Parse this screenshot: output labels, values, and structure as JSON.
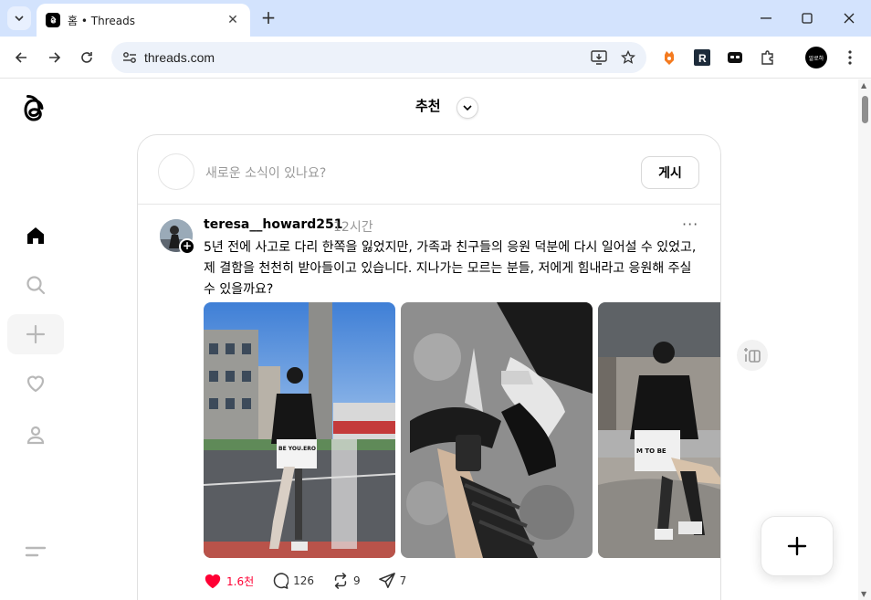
{
  "browser": {
    "tab_title": "홈 • Threads",
    "url": "threads.com",
    "profile_label": "알로하"
  },
  "feed": {
    "header_title": "추천"
  },
  "composer": {
    "placeholder": "새로운 소식이 있나요?",
    "post_button": "게시"
  },
  "post": {
    "username": "teresa__howard251",
    "time_ago": "12시간",
    "text": "5년 전에 사고로 다리 한쪽을 잃었지만, 가족과 친구들의 응원 덕분에 다시 일어설 수 있었고, 제 결함을 천천히 받아들이고 있습니다. 지나가는 모르는 분들, 저에게 힘내라고 응원해 주실 수 있을까요?",
    "photo_signs": [
      "BE YOU.ERO",
      "M TO BE"
    ],
    "likes": "1.6천",
    "comments": "126",
    "reposts": "9",
    "shares": "7",
    "liked": true,
    "accent_like_color": "#ff0034"
  },
  "icons": {
    "sidebar": [
      "threads-logo-icon",
      "home-icon",
      "search-icon",
      "create-plus-icon",
      "heart-icon",
      "profile-icon",
      "menu-icon"
    ]
  }
}
